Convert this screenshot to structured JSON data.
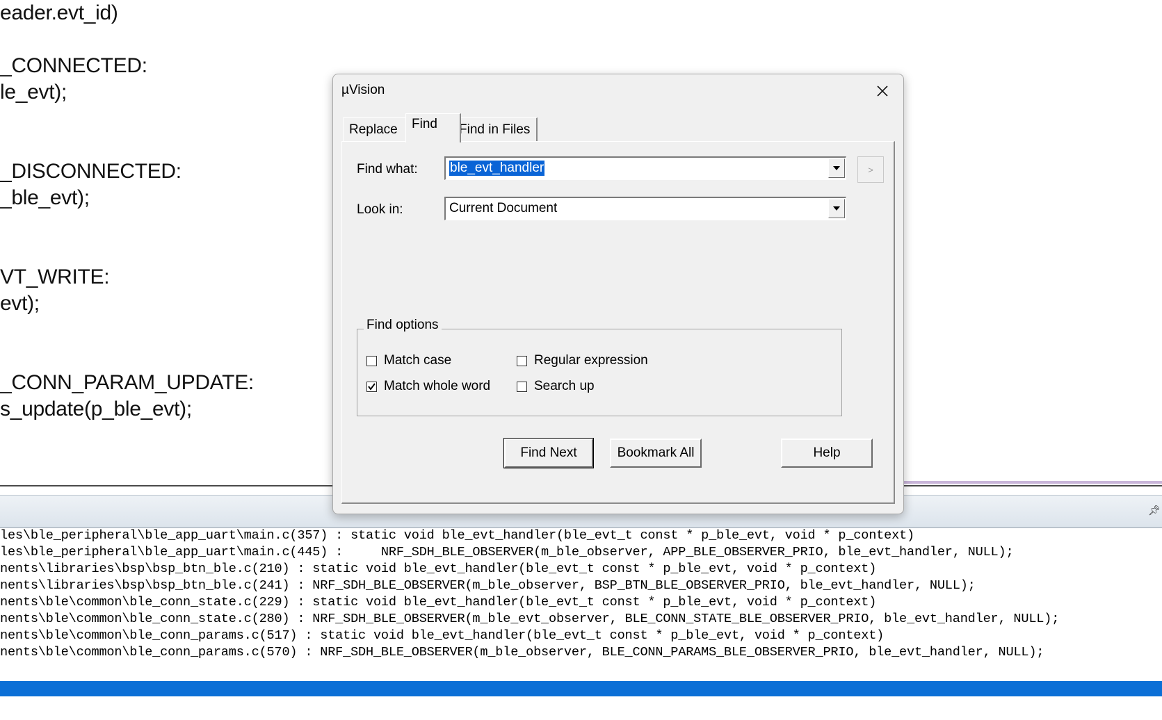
{
  "editor": {
    "lines": [
      "eader.evt_id)",
      "_CONNECTED:",
      "le_evt);",
      "_DISCONNECTED:",
      "_ble_evt);",
      "VT_WRITE:",
      "evt);",
      "_CONN_PARAM_UPDATE:",
      "s_update(p_ble_evt);"
    ]
  },
  "dialog": {
    "title": "µVision",
    "tabs": [
      "Replace",
      "Find",
      "Find in Files"
    ],
    "active_tab": "Find",
    "find_what_label": "Find what:",
    "find_what_value": "ble_evt_handler",
    "look_in_label": "Look in:",
    "look_in_value": "Current Document",
    "regex_helper_label": ">",
    "options_label": "Find options",
    "options": {
      "match_case": {
        "label": "Match case",
        "checked": false
      },
      "match_whole_word": {
        "label": "Match whole word",
        "checked": true
      },
      "regular_expression": {
        "label": "Regular expression",
        "checked": false
      },
      "search_up": {
        "label": "Search up",
        "checked": false
      }
    },
    "buttons": {
      "find_next": "Find Next",
      "bookmark_all": "Bookmark All",
      "help": "Help"
    }
  },
  "output": {
    "lines": [
      "les\\ble_peripheral\\ble_app_uart\\main.c(357) : static void ble_evt_handler(ble_evt_t const * p_ble_evt, void * p_context)",
      "les\\ble_peripheral\\ble_app_uart\\main.c(445) :     NRF_SDH_BLE_OBSERVER(m_ble_observer, APP_BLE_OBSERVER_PRIO, ble_evt_handler, NULL);",
      "nents\\libraries\\bsp\\bsp_btn_ble.c(210) : static void ble_evt_handler(ble_evt_t const * p_ble_evt, void * p_context)",
      "nents\\libraries\\bsp\\bsp_btn_ble.c(241) : NRF_SDH_BLE_OBSERVER(m_ble_observer, BSP_BTN_BLE_OBSERVER_PRIO, ble_evt_handler, NULL);",
      "nents\\ble\\common\\ble_conn_state.c(229) : static void ble_evt_handler(ble_evt_t const * p_ble_evt, void * p_context)",
      "nents\\ble\\common\\ble_conn_state.c(280) : NRF_SDH_BLE_OBSERVER(m_ble_evt_observer, BLE_CONN_STATE_BLE_OBSERVER_PRIO, ble_evt_handler, NULL);",
      "nents\\ble\\common\\ble_conn_params.c(517) : static void ble_evt_handler(ble_evt_t const * p_ble_evt, void * p_context)",
      "nents\\ble\\common\\ble_conn_params.c(570) : NRF_SDH_BLE_OBSERVER(m_ble_observer, BLE_CONN_PARAMS_BLE_OBSERVER_PRIO, ble_evt_handler, NULL);"
    ]
  },
  "colors": {
    "status_bar": "#0b6fd6",
    "selection": "#0a64d6",
    "dialog_bg": "#f0f0f0"
  },
  "icons": {
    "close": "close-icon",
    "dropdown": "chevron-down-icon",
    "pin": "pin-icon",
    "checkmark": "checkmark-icon"
  }
}
